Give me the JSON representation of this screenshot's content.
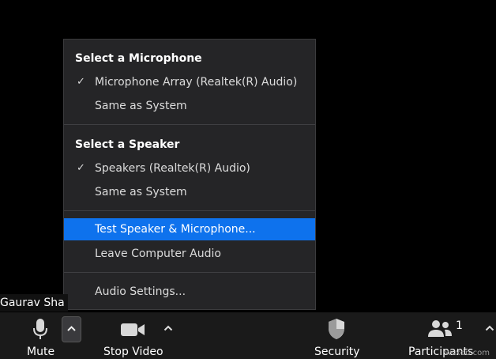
{
  "menu": {
    "microphone_heading": "Select a Microphone",
    "microphone_items": [
      {
        "label": "Microphone Array (Realtek(R) Audio)",
        "checked": true
      },
      {
        "label": "Same as System",
        "checked": false
      }
    ],
    "speaker_heading": "Select a Speaker",
    "speaker_items": [
      {
        "label": "Speakers (Realtek(R) Audio)",
        "checked": true
      },
      {
        "label": "Same as System",
        "checked": false
      }
    ],
    "test_label": "Test Speaker & Microphone...",
    "leave_label": "Leave Computer Audio",
    "settings_label": "Audio Settings...",
    "check_glyph": "✓"
  },
  "participant_name": "Gaurav Sha",
  "toolbar": {
    "mute_label": "Mute",
    "stop_video_label": "Stop Video",
    "security_label": "Security",
    "participants_label": "Participants",
    "participants_count": "1"
  },
  "watermark": "wsxdn.com",
  "colors": {
    "highlight": "#0e72ed",
    "menu_bg": "#252527",
    "toolbar_bg": "#1a1a1a"
  },
  "icons": [
    "microphone-icon",
    "video-camera-icon",
    "shield-icon",
    "participants-icon",
    "chevron-up-icon",
    "check-icon"
  ]
}
